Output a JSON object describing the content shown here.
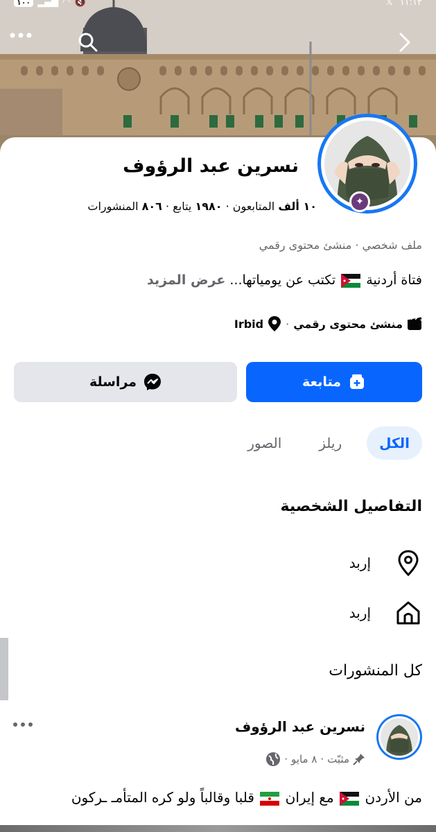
{
  "status_bar": {
    "time": "١١:١٢",
    "battery": "١٠٠"
  },
  "profile": {
    "name": "نسرين عبد الرؤوف",
    "stats_followers_value": "١٠ ألف",
    "stats_followers_label": "المتابعون",
    "stats_following_value": "١٩٨٠",
    "stats_following_label": "يتابع",
    "stats_posts_value": "٨٠٦",
    "stats_posts_label": "المنشورات",
    "category": "ملف شخصي · منشئ محتوى رقمي",
    "bio_text_before": "فتاة أردنية",
    "bio_text_after": "تكتب عن يومياتها...",
    "bio_more": "عرض المزيد",
    "meta_category": "منشئ محتوى رقمي",
    "meta_location": "Irbid"
  },
  "actions": {
    "follow_label": "متابعة",
    "message_label": "مراسلة"
  },
  "tabs": [
    {
      "label": "الكل",
      "active": true
    },
    {
      "label": "ريلز",
      "active": false
    },
    {
      "label": "الصور",
      "active": false
    }
  ],
  "details": {
    "title": "التفاصيل الشخصية",
    "current_city": "إربد",
    "hometown": "إربد"
  },
  "posts": {
    "title": "كل المنشورات",
    "author": "نسرين عبد الرؤوف",
    "pinned_label": "مثبّت",
    "date": "٨ مايو",
    "text_start": "من الأردن",
    "text_middle": "مع إيران",
    "text_end": "قلبا وقالباً ولو كره المتأمـ ـركون"
  },
  "colors": {
    "accent": "#0866ff",
    "avatar_ring": "#1877f2",
    "secondary_text": "#65676b",
    "button_gray": "#e4e6eb",
    "tab_active_bg": "#e7f0fd"
  },
  "icons": {
    "back": "chevron-right-icon",
    "search": "search-icon",
    "more": "more-horizontal-icon",
    "follow": "add-friend-icon",
    "message": "messenger-icon",
    "location": "location-pin-icon",
    "home": "home-icon",
    "category": "clapperboard-icon",
    "pin": "pin-icon",
    "privacy": "globe-icon"
  }
}
